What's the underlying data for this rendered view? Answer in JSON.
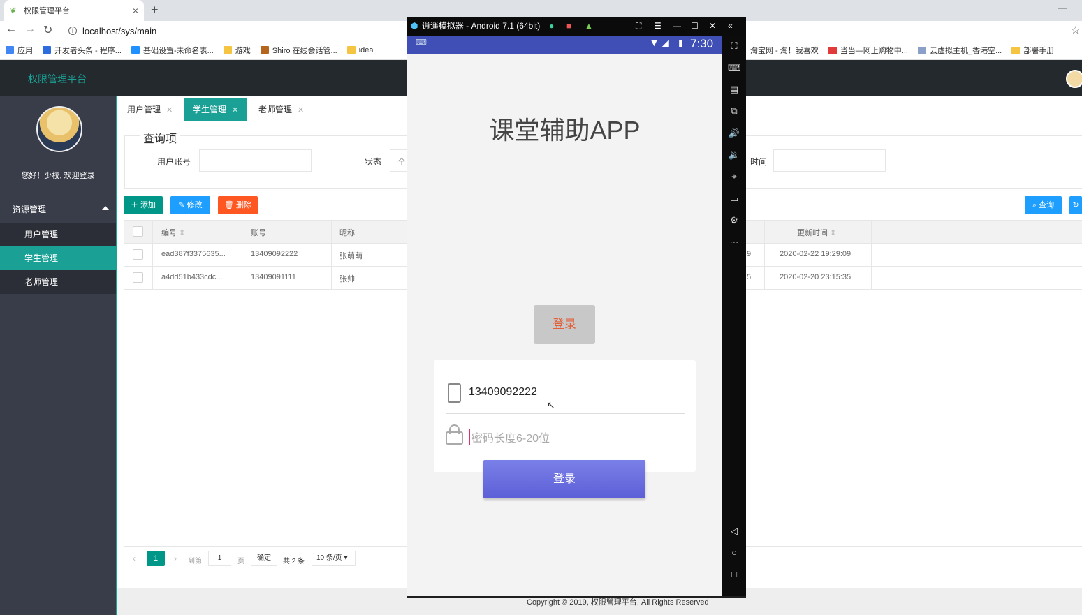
{
  "browser": {
    "tab_title": "权限管理平台",
    "url": "localhost/sys/main",
    "bookmarks": [
      "应用",
      "开发者头条 - 程序...",
      "基础设置-未命名表...",
      "游戏",
      "Shiro 在线会话管...",
      "idea",
      "淘宝网 - 淘！我喜欢",
      "当当—网上购物中...",
      "云虚拟主机_香港空...",
      "部署手册"
    ]
  },
  "app": {
    "title": "权限管理平台",
    "welcome": "您好！少校, 欢迎登录",
    "menu_group": "资源管理",
    "menu_items": [
      "用户管理",
      "学生管理",
      "老师管理"
    ],
    "tabs": [
      "用户管理",
      "学生管理",
      "老师管理"
    ],
    "query": {
      "legend": "查询项",
      "account_label": "用户账号",
      "status_label": "状态",
      "status_value": "全",
      "time_label": "时间"
    },
    "buttons": {
      "add": "添加",
      "edit": "修改",
      "delete": "删除",
      "search": "查询"
    },
    "table": {
      "headers": [
        "编号",
        "账号",
        "昵称",
        "更新时间"
      ],
      "rows": [
        {
          "id": "ead387f3375635...",
          "account": "13409092222",
          "nickname": "张萌萌",
          "hidden": "9",
          "updated": "2020-02-22 19:29:09"
        },
        {
          "id": "a4dd51b433cdc...",
          "account": "13409091111",
          "nickname": "张帅",
          "hidden": "5",
          "updated": "2020-02-20 23:15:35"
        }
      ]
    },
    "pager": {
      "current": "1",
      "goto": "到第",
      "page_input": "1",
      "page_suffix": "页",
      "confirm": "确定",
      "total": "共 2 条",
      "size": "10 条/页"
    },
    "footer": "Copyright © 2019, 权限管理平台, All Rights Reserved"
  },
  "emulator": {
    "title": "逍遥模拟器 - Android 7.1 (64bit)",
    "time": "7:30",
    "app_title": "课堂辅助APP",
    "gray_button": "登录",
    "phone_value": "13409092222",
    "password_placeholder": "密码长度6-20位",
    "login_button": "登录"
  }
}
